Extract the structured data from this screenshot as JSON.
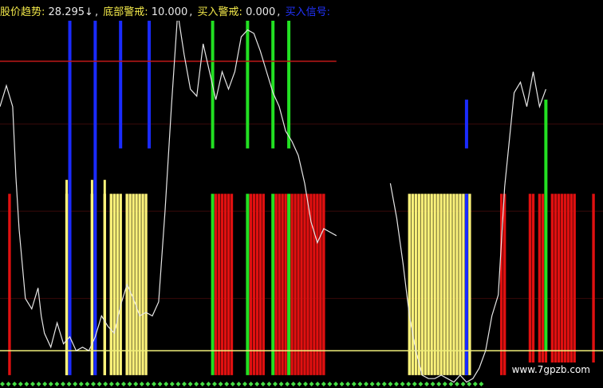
{
  "legend": {
    "trend_label": "股价趋势:",
    "trend_value": "28.295",
    "trend_arrow": "↓",
    "bottom_warning_label": "底部警戒:",
    "bottom_warning_value": "10.000",
    "buy_warning_label": "买入警戒:",
    "buy_warning_value": "0.000",
    "buy_signal_label": "买入信号:"
  },
  "watermark": "www.7gpzb.com",
  "colors": {
    "background": "#000000",
    "trend_line": "#e6e6e6",
    "bottom_level": "#f0ef7a",
    "top_level": "#c01818",
    "red_bar": "#e01010",
    "yellow_bar": "#fbf27a",
    "green_line": "#22e022",
    "blue_line": "#1a2bff",
    "diamond": "#44dd44",
    "grid": "#3a0a0a"
  },
  "chart_data": {
    "type": "line",
    "xlim": [
      0,
      190
    ],
    "ylim": [
      0,
      106
    ],
    "grid": true,
    "reference_lines": [
      {
        "name": "底部警戒",
        "value": 10
      },
      {
        "name": "top",
        "value": 93
      }
    ],
    "series": [
      {
        "name": "股价趋势",
        "x": [
          0,
          2,
          4,
          5,
          6,
          8,
          10,
          12,
          13,
          14,
          16,
          18,
          20,
          22,
          24,
          26,
          28,
          30,
          32,
          34,
          36,
          38,
          40,
          42,
          44,
          46,
          48,
          50,
          52,
          54,
          56,
          58,
          60,
          62,
          64,
          68,
          70,
          72,
          74,
          76,
          78,
          80,
          82,
          84,
          86,
          88,
          90,
          92,
          94,
          96,
          98,
          100,
          102,
          104,
          106
        ],
        "y": [
          80,
          86,
          80,
          60,
          45,
          25,
          22,
          28,
          20,
          15,
          11,
          18,
          12,
          14,
          10,
          11,
          10,
          14,
          20,
          17,
          15,
          23,
          29,
          25,
          20,
          21,
          20,
          24,
          50,
          80,
          107,
          95,
          85,
          83,
          98,
          82,
          90,
          85,
          90,
          100,
          102,
          101,
          96,
          90,
          84,
          80,
          73,
          70,
          66,
          58,
          47,
          41,
          45,
          44,
          43
        ]
      },
      {
        "name": "股价趋势",
        "x": [
          123,
          125,
          127,
          129,
          131,
          133,
          135,
          137,
          139,
          141,
          143,
          145,
          147,
          149,
          151,
          153,
          155,
          157,
          159,
          162,
          164,
          166,
          168,
          170,
          172
        ],
        "y": [
          58,
          48,
          35,
          20,
          10,
          3,
          2,
          2,
          3,
          2,
          1,
          3,
          1,
          2,
          5,
          10,
          20,
          26,
          57,
          84,
          87,
          80,
          90,
          80,
          85
        ]
      }
    ],
    "bars": {
      "red": {
        "low": 3,
        "high": 55,
        "x": [
          3,
          68,
          69,
          70,
          71,
          72,
          73,
          79,
          80,
          81,
          82,
          83,
          87,
          88,
          89,
          90,
          92,
          93,
          94,
          95,
          96,
          97,
          98,
          99,
          100,
          101,
          102,
          158,
          159,
          167,
          168,
          170,
          171,
          172,
          174,
          175,
          176,
          177,
          178,
          179,
          180,
          181,
          187
        ]
      },
      "yellow": {
        "low": 3,
        "high": 55,
        "x": [
          21,
          29,
          33,
          35,
          36,
          37,
          38,
          40,
          41,
          42,
          43,
          44,
          45,
          46,
          129,
          130,
          131,
          132,
          133,
          134,
          135,
          136,
          137,
          138,
          139,
          140,
          141,
          142,
          143,
          144,
          145,
          146,
          147,
          148
        ]
      },
      "green": [
        {
          "x": 67,
          "low": 3,
          "high": 55
        },
        {
          "x": 78,
          "low": 3,
          "high": 55
        },
        {
          "x": 86,
          "low": 3,
          "high": 55
        },
        {
          "x": 91,
          "low": 3,
          "high": 55
        },
        {
          "x": 67,
          "low": 68,
          "high": 106
        },
        {
          "x": 78,
          "low": 68,
          "high": 106
        },
        {
          "x": 86,
          "low": 68,
          "high": 106
        },
        {
          "x": 91,
          "low": 68,
          "high": 106
        },
        {
          "x": 172,
          "low": 10,
          "high": 82
        }
      ],
      "blue": [
        {
          "x": 22,
          "low": 3,
          "high": 106
        },
        {
          "x": 30,
          "low": 3,
          "high": 106
        },
        {
          "x": 38,
          "low": 68,
          "high": 106
        },
        {
          "x": 47,
          "low": 68,
          "high": 106
        },
        {
          "x": 147,
          "low": 3,
          "high": 55
        },
        {
          "x": 147,
          "low": 68,
          "high": 82
        }
      ]
    },
    "upper_yellow_lines": {
      "low": 3,
      "high": 59,
      "x": [
        21,
        29,
        33
      ]
    }
  }
}
